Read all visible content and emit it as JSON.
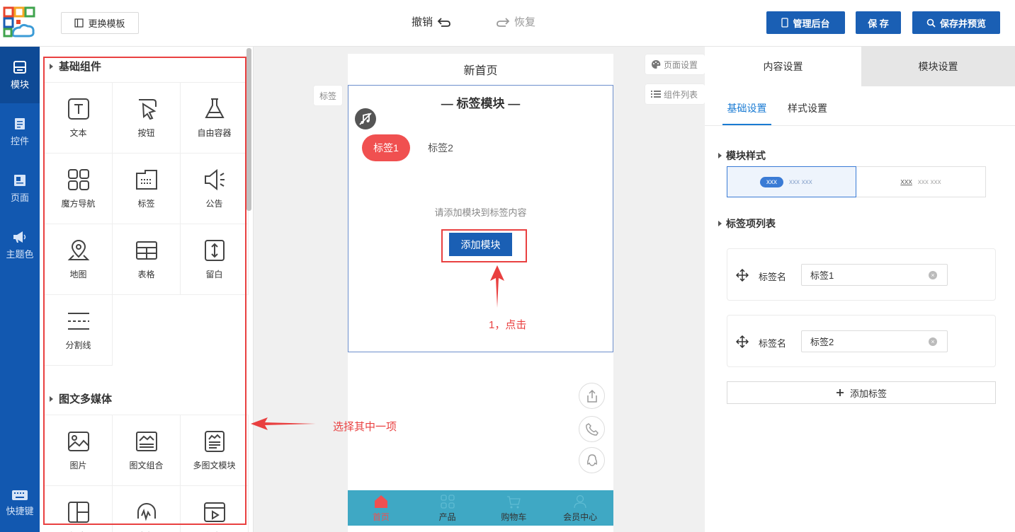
{
  "toolbar": {
    "template_label": "更换模板",
    "undo_label": "撤销",
    "redo_label": "恢复",
    "admin_label": "管理后台",
    "save_label": "保 存",
    "save_preview_label": "保存并预览"
  },
  "leftnav": {
    "items": [
      {
        "label": "模块",
        "icon": "module-icon"
      },
      {
        "label": "控件",
        "icon": "widget-icon"
      },
      {
        "label": "页面",
        "icon": "page-icon"
      },
      {
        "label": "主题色",
        "icon": "megaphone-icon"
      }
    ],
    "shortcut_label": "快捷键"
  },
  "panel": {
    "section_basic": "基础组件",
    "basic": [
      "文本",
      "按钮",
      "自由容器",
      "魔方导航",
      "标签",
      "公告",
      "地图",
      "表格",
      "留白",
      "分割线"
    ],
    "section_media": "图文多媒体",
    "media": [
      "图片",
      "图文组合",
      "多图文模块",
      "橱窗",
      "音频",
      "视频"
    ]
  },
  "canvas": {
    "side_tag": "标签",
    "page_settings": "页面设置",
    "component_list": "组件列表",
    "page_title": "新首页",
    "module_title": "— 标签模块 —",
    "tab1": "标签1",
    "tab2": "标签2",
    "empty_text": "请添加模块到标签内容",
    "add_module": "添加模块",
    "bottom_nav": [
      "首页",
      "产品",
      "购物车",
      "会员中心"
    ]
  },
  "annotations": {
    "click": "1，点击",
    "select": "选择其中一项"
  },
  "right": {
    "tab_content": "内容设置",
    "tab_module": "模块设置",
    "subtab_basic": "基础设置",
    "subtab_style": "样式设置",
    "section_style": "模块样式",
    "style1_pill": "xxx",
    "style1_rest": "xxx  xxx",
    "style2_first": "xxx",
    "style2_rest": "xxx  xxx",
    "section_tags": "标签项列表",
    "tag_name_label": "标签名",
    "tags": [
      "标签1",
      "标签2"
    ],
    "add_tag": "添加标签"
  },
  "colors": {
    "primary": "#1a5fb4",
    "nav_bg": "#1258b0",
    "tab_active": "#f05050",
    "bottom_nav_bg": "#3fa8c4",
    "annotation": "#e94040"
  }
}
